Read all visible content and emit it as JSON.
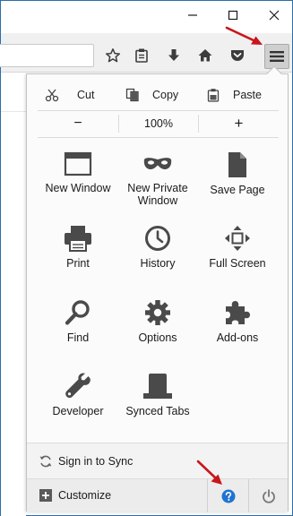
{
  "colors": {
    "annotation_arrow": "#c8161d",
    "help_blue": "#1f73d1",
    "icon_dark": "#4a4a4a"
  },
  "titlebar": {
    "minimize": {
      "icon": "minimize-icon"
    },
    "maximize": {
      "icon": "maximize-icon"
    },
    "close": {
      "icon": "close-icon"
    }
  },
  "toolbar": {
    "buttons": [
      {
        "name": "bookmark-star",
        "icon": "star-icon"
      },
      {
        "name": "reading-list",
        "icon": "clipboard-icon"
      },
      {
        "name": "downloads",
        "icon": "download-arrow-icon"
      },
      {
        "name": "home",
        "icon": "home-icon"
      },
      {
        "name": "pocket",
        "icon": "pocket-icon"
      },
      {
        "name": "open-menu",
        "icon": "hamburger-icon"
      }
    ]
  },
  "menu": {
    "edit": {
      "cut": "Cut",
      "copy": "Copy",
      "paste": "Paste"
    },
    "zoom": {
      "minus": "−",
      "level": "100%",
      "plus": "+"
    },
    "tiles": [
      {
        "label": "New Window",
        "icon": "window-icon"
      },
      {
        "label": "New Private Window",
        "icon": "mask-icon"
      },
      {
        "label": "Save Page",
        "icon": "page-icon"
      },
      {
        "label": "Print",
        "icon": "printer-icon"
      },
      {
        "label": "History",
        "icon": "clock-icon"
      },
      {
        "label": "Full Screen",
        "icon": "fullscreen-icon"
      },
      {
        "label": "Find",
        "icon": "magnifier-icon"
      },
      {
        "label": "Options",
        "icon": "gear-icon"
      },
      {
        "label": "Add-ons",
        "icon": "puzzle-icon"
      },
      {
        "label": "Developer",
        "icon": "wrench-icon"
      },
      {
        "label": "Synced Tabs",
        "icon": "synced-tabs-icon"
      }
    ],
    "footer": {
      "sync": "Sign in to Sync",
      "customize": "Customize",
      "help_icon": "help-icon",
      "quit_icon": "power-icon"
    }
  }
}
